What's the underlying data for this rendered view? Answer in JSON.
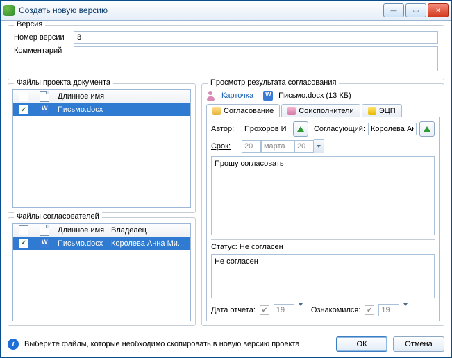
{
  "window": {
    "title": "Создать новую версию"
  },
  "version": {
    "group_label": "Версия",
    "number_label": "Номер версии",
    "number_value": "3",
    "comment_label": "Комментарий",
    "comment_value": ""
  },
  "project_files": {
    "group_label": "Файлы проекта документа",
    "columns": {
      "name": "Длинное имя"
    },
    "rows": [
      {
        "checked": true,
        "name": "Письмо.docx",
        "selected": true
      }
    ]
  },
  "approver_files": {
    "group_label": "Файлы согласователей",
    "columns": {
      "name": "Длинное имя",
      "owner": "Владелец"
    },
    "rows": [
      {
        "checked": true,
        "name": "Письмо.docx",
        "owner": "Королева Анна Ми...",
        "selected": true
      }
    ]
  },
  "viewer": {
    "group_label": "Просмотр результата согласования",
    "card_link": "Карточка",
    "file_text": "Письмо.docx (13 КБ)",
    "tabs": {
      "approval": "Согласование",
      "coexec": "Соисполнители",
      "eds": "ЭЦП"
    },
    "author_label": "Автор:",
    "author_value": "Прохоров Иг",
    "approver_label": "Согласующий:",
    "approver_value": "Королева Ан",
    "deadline_label": "Срок:",
    "deadline_day": "20",
    "deadline_month": "марта",
    "deadline_year": "20",
    "message": "Прошу согласовать",
    "status_label": "Статус: ",
    "status_value": "Не согласен",
    "status_message": "Не согласен",
    "report_date_label": "Дата отчета:",
    "report_date_value": "19",
    "ack_label": "Ознакомился:",
    "ack_value": "19"
  },
  "footer": {
    "hint": "Выберите файлы, которые необходимо скопировать в новую версию проекта",
    "ok": "ОК",
    "cancel": "Отмена"
  }
}
